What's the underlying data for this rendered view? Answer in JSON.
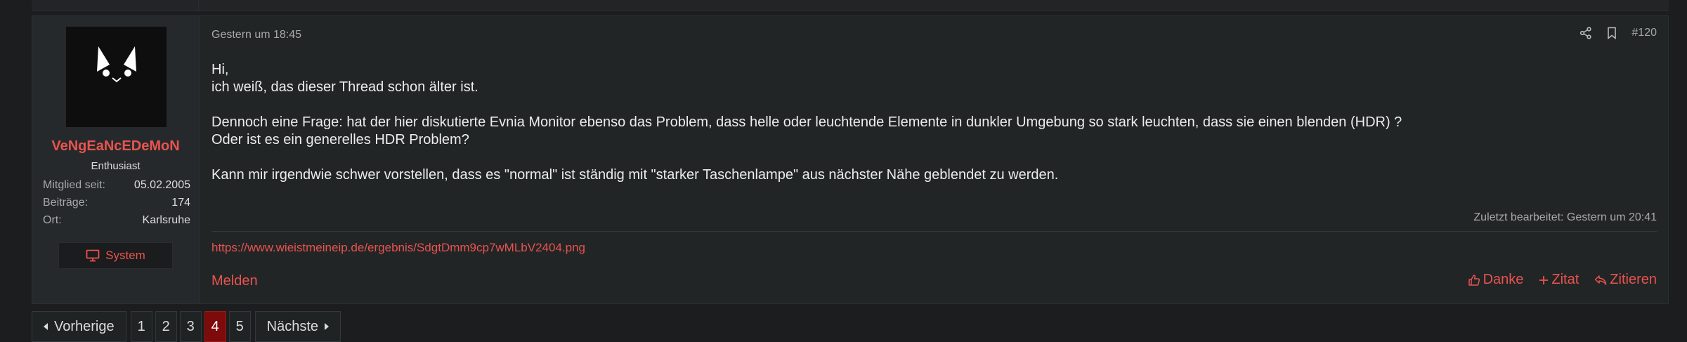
{
  "post": {
    "author": {
      "username": "VeNgEaNcEDeMoN",
      "title": "Enthusiast",
      "stats": [
        {
          "label": "Mitglied seit:",
          "value": "05.02.2005"
        },
        {
          "label": "Beiträge:",
          "value": "174"
        },
        {
          "label": "Ort:",
          "value": "Karlsruhe"
        }
      ],
      "system_label": "System"
    },
    "date": "Gestern um 18:45",
    "number": "#120",
    "body": {
      "line1": "Hi,",
      "line2": "ich weiß, das dieser Thread schon älter ist.",
      "line3": "Dennoch eine Frage: hat der hier diskutierte Evnia Monitor ebenso das Problem, dass helle oder leuchtende Elemente in dunkler Umgebung so stark leuchten, dass sie einen blenden (HDR) ?",
      "line4": "Oder ist es ein generelles HDR Problem?",
      "line5": "Kann mir irgendwie schwer vorstellen, dass es \"normal\" ist ständig mit \"starker Taschenlampe\" aus nächster Nähe geblendet zu werden."
    },
    "edited": "Zuletzt bearbeitet: Gestern um 20:41",
    "signature_link": "https://www.wieistmeineip.de/ergebnis/SdgtDmm9cp7wMLbV2404.png",
    "report_label": "Melden",
    "actions": {
      "thanks": "Danke",
      "quote_add": "Zitat",
      "quote": "Zitieren"
    }
  },
  "pagination": {
    "prev_label": "Vorherige",
    "pages": [
      "1",
      "2",
      "3",
      "4",
      "5"
    ],
    "current_page": "4",
    "next_label": "Nächste"
  },
  "colors": {
    "accent": "#e9534f",
    "active_page": "#7d0b0b",
    "background": "#1b1d1e",
    "panel": "#222526"
  }
}
